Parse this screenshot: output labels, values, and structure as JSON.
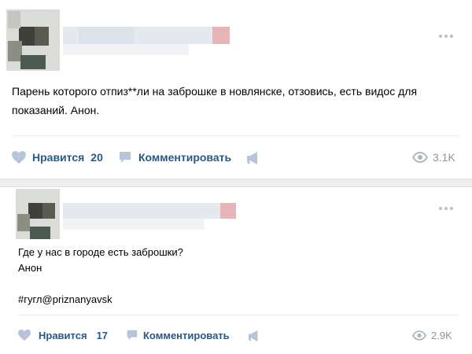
{
  "post1": {
    "text_line1": "Парень которого отпиз**ли на заброшке в новлянске, отзовись, есть видос для",
    "text_line2": "показаний. Анон.",
    "like_label": "Нравится",
    "like_count": "20",
    "comment_label": "Комментировать",
    "views": "3.1K"
  },
  "post2": {
    "text_line1": "Где у нас в городе есть заброшки?",
    "text_line2": "Анон",
    "text_line3": "#гугл@priznanyavsk",
    "like_label": "Нравится",
    "like_count": "17",
    "comment_label": "Комментировать",
    "views": "2.9K"
  },
  "colors": {
    "background": "#edeef0",
    "card": "#ffffff",
    "link": "#2a5885",
    "icon": "#b6c5d8",
    "muted": "#939393"
  },
  "icons": [
    "heart-icon",
    "comment-icon",
    "share-megaphone-icon",
    "eye-icon",
    "more-dots-icon"
  ]
}
